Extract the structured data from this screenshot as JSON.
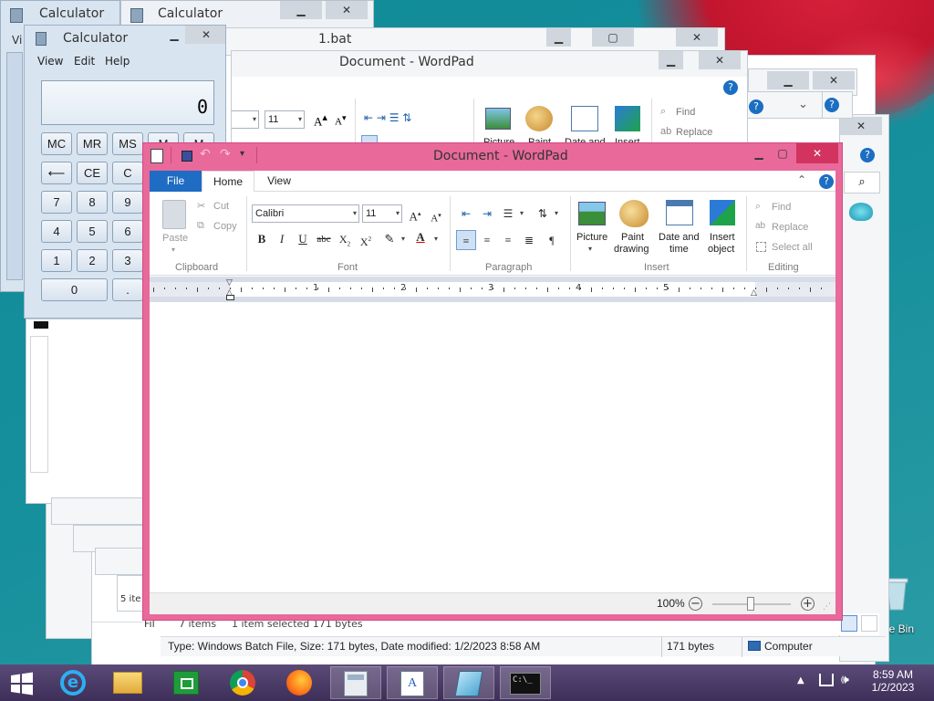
{
  "colors": {
    "wordpad_frame": "#e8699a",
    "file_tab": "#1e6cc4",
    "desktop": "#168c9a",
    "taskbar": "#4a3b66"
  },
  "calc_back1": {
    "title": "Calculator",
    "menu_view": "Vi"
  },
  "calc_back2": {
    "title": "Calculator"
  },
  "calc_front": {
    "title": "Calculator",
    "menu": [
      "View",
      "Edit",
      "Help"
    ],
    "display": "0",
    "row1": [
      "MC",
      "MR",
      "MS",
      "M",
      "M"
    ],
    "row2": [
      "⟵",
      "CE",
      "C"
    ],
    "row3": [
      "7",
      "8",
      "9"
    ],
    "row4": [
      "4",
      "5",
      "6"
    ],
    "row5": [
      "1",
      "2",
      "3"
    ],
    "row6": [
      "0",
      "."
    ]
  },
  "notepad": {
    "title": "1.bat"
  },
  "wordpad_back": {
    "title": "Document - WordPad",
    "font_size": "11",
    "items": [
      "Picture",
      "Paint",
      "Date and",
      "Insert"
    ],
    "find": "Find",
    "replace": "Replace"
  },
  "explorer": {
    "status_items": "7 items",
    "status_selected": "1 item selected  171 bytes",
    "details": "Type: Windows Batch File, Size: 171 bytes, Date modified: 1/2/2023 8:58 AM",
    "size": "171 bytes",
    "computer": "Computer",
    "fi": "Fil",
    "jitem": "5 ite"
  },
  "desktop": {
    "recycle_label": "cle Bin"
  },
  "wordpad": {
    "title": "Document - WordPad",
    "tabs": {
      "file": "File",
      "home": "Home",
      "view": "View"
    },
    "clipboard": {
      "paste": "Paste",
      "cut": "Cut",
      "copy": "Copy",
      "group": "Clipboard"
    },
    "font": {
      "name": "Calibri",
      "size": "11",
      "group": "Font"
    },
    "paragraph": {
      "group": "Paragraph"
    },
    "insert": {
      "picture": "Picture",
      "paint1": "Paint",
      "paint2": "drawing",
      "date1": "Date and",
      "date2": "time",
      "obj1": "Insert",
      "obj2": "object",
      "group": "Insert"
    },
    "editing": {
      "find": "Find",
      "replace": "Replace",
      "select_all": "Select all",
      "group": "Editing"
    },
    "ruler": [
      "1",
      "2",
      "3",
      "4",
      "5"
    ],
    "zoom": "100%"
  },
  "taskbar": {
    "time": "8:59 AM",
    "date": "1/2/2023"
  }
}
